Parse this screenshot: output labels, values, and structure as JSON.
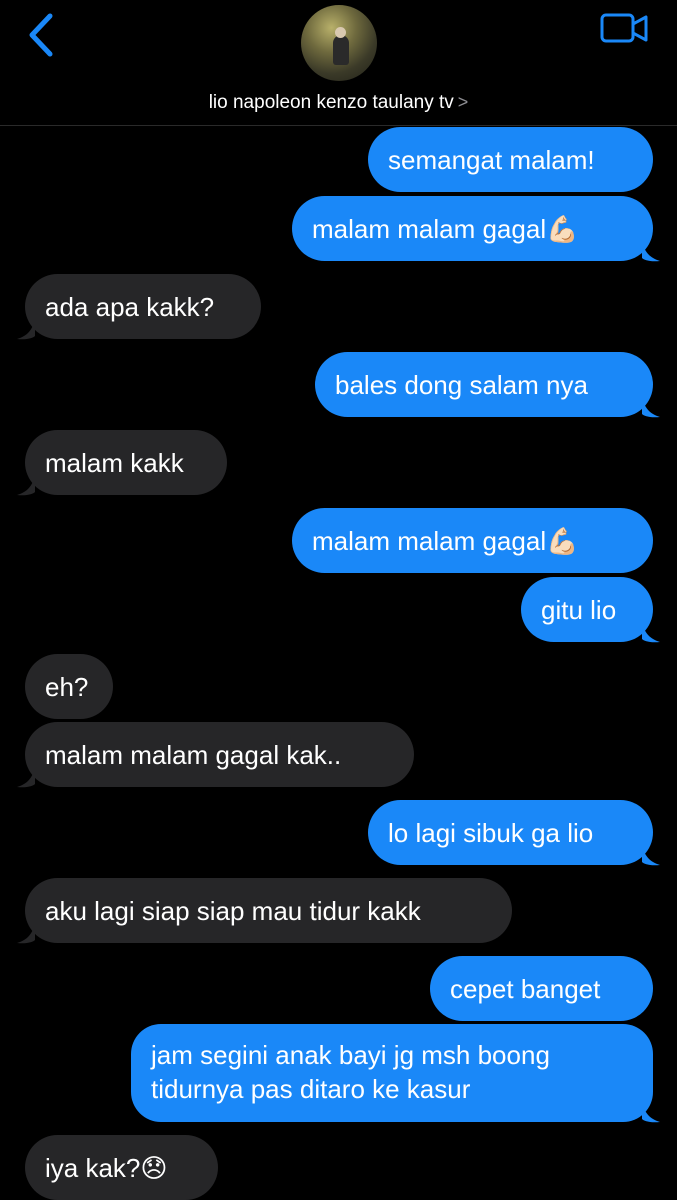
{
  "header": {
    "contact_name": "lio napoleon kenzo taulany tv",
    "chevron": ">",
    "back_icon": "chevron-left-icon",
    "video_icon": "video-camera-icon",
    "accent_color": "#1a88f8"
  },
  "messages": [
    {
      "from": "me",
      "text": "semangat malam!"
    },
    {
      "from": "me",
      "text": "malam malam gagal💪🏻"
    },
    {
      "from": "them",
      "text": "ada apa kakk?"
    },
    {
      "from": "me",
      "text": "bales dong salam nya"
    },
    {
      "from": "them",
      "text": "malam kakk"
    },
    {
      "from": "me",
      "text": "malam malam gagal💪🏻"
    },
    {
      "from": "me",
      "text": "gitu lio"
    },
    {
      "from": "them",
      "text": "eh?"
    },
    {
      "from": "them",
      "text": "malam malam gagal kak.."
    },
    {
      "from": "me",
      "text": "lo lagi sibuk ga lio"
    },
    {
      "from": "them",
      "text": "aku lagi siap siap mau tidur kakk"
    },
    {
      "from": "me",
      "text": "cepet banget"
    },
    {
      "from": "me",
      "text": "jam segini anak bayi jg msh boong tidurnya pas ditaro ke kasur"
    },
    {
      "from": "them",
      "text": "iya kak?😞"
    }
  ]
}
